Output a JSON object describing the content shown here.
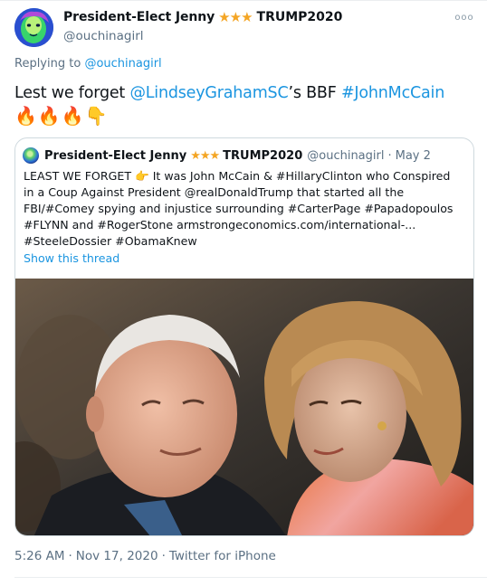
{
  "tweet": {
    "author": {
      "display_name": "President-Elect Jenny",
      "stars": "★★★",
      "name_suffix": "TRUMP2020",
      "handle": "@ouchinagirl",
      "avatar_icon": "neon-face-avatar-icon"
    },
    "more_icon": "more-options-icon",
    "more_label": "ooo",
    "replying": {
      "prefix": "Replying to",
      "handle": "@ouchinagirl"
    },
    "text": {
      "part1": "Lest we forget ",
      "mention": "@LindseyGrahamSC",
      "part2": "’s BBF ",
      "hashtag": "#JohnMcCain"
    },
    "emojis": "🔥🔥🔥👇",
    "timestamp": {
      "time": "5:26 AM",
      "date": "Nov 17, 2020",
      "source": "Twitter for iPhone",
      "separator": "·"
    }
  },
  "quoted_tweet": {
    "display_name": "President-Elect Jenny",
    "stars": "★★★",
    "name_suffix": "TRUMP2020",
    "handle": "@ouchinagirl",
    "separator": "·",
    "date": "May 2",
    "lines": [
      "LEAST WE FORGET 👉 It was John McCain & #HillaryClinton who Conspired",
      "in a Coup Against President @realDonaldTrump that started all the",
      "FBI/#Comey spying and injustice surrounding #CarterPage #Papadopoulos",
      "#FLYNN and #RogerStone armstrongeconomics.com/international-...",
      "#SteeleDossier #ObamaKnew"
    ],
    "show_thread": "Show this thread",
    "image_icon": "photo-two-politicians-icon"
  },
  "colors": {
    "link": "#1b95e0",
    "secondary_text": "#5b7083",
    "star": "#f4a524",
    "border": "#cfd9de"
  }
}
